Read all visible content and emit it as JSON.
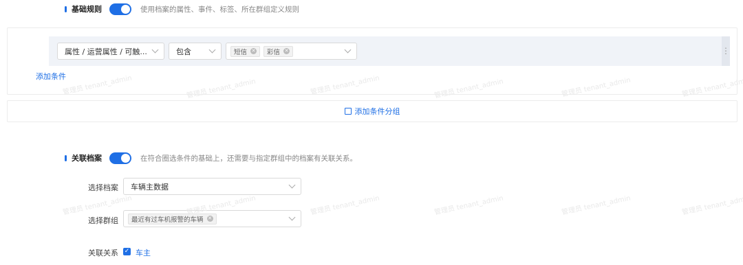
{
  "basic_rule": {
    "title": "基础规则",
    "description": "使用档案的属性、事件、标签、所在群组定义规则",
    "enabled": true
  },
  "condition": {
    "field_value": "属性 / 运营属性 / 可触...",
    "operator_value": "包含",
    "tags": [
      "短信",
      "彩信"
    ]
  },
  "add_condition_label": "添加条件",
  "add_group_label": "添加条件分组",
  "related": {
    "title": "关联档案",
    "description": "在符合圈选条件的基础上，还需要与指定群组中的档案有关联关系。",
    "enabled": true,
    "select_archive_label": "选择档案",
    "select_archive_value": "车辆主数据",
    "select_group_label": "选择群组",
    "group_tags": [
      "最近有过车机报警的车辆"
    ],
    "relation_label": "关联关系",
    "relation_option": "车主",
    "relation_checked": true
  },
  "watermark": "管理员 tenant_admin"
}
